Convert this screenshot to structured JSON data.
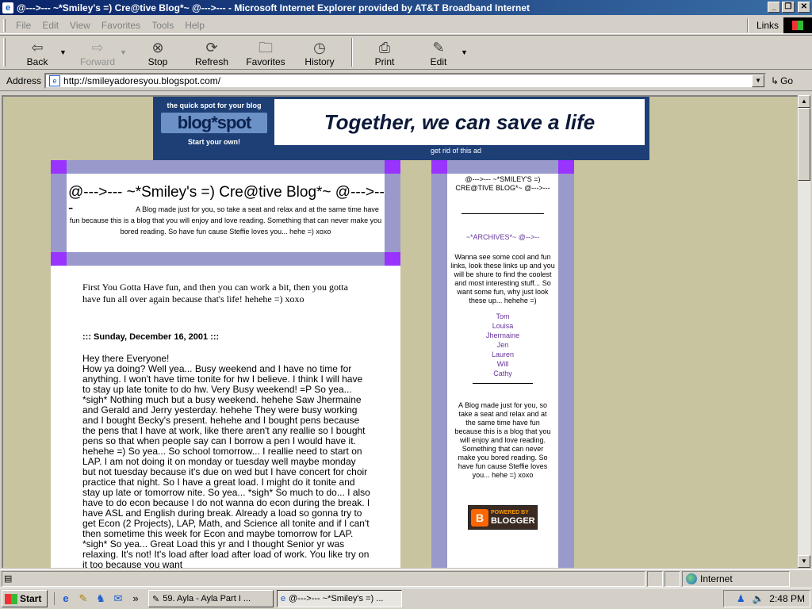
{
  "window": {
    "title": "@--->--- ~*Smiley's =) Cre@tive Blog*~ @--->--- - Microsoft Internet Explorer provided by AT&T Broadband Internet",
    "min_icon": "_",
    "max_icon": "❐",
    "close_icon": "✕"
  },
  "menubar": {
    "items": [
      "File",
      "Edit",
      "View",
      "Favorites",
      "Tools",
      "Help"
    ],
    "links_label": "Links"
  },
  "toolbar": {
    "buttons": [
      {
        "label": "Back",
        "icon": "back-arrow-icon",
        "glyph": "⇦"
      },
      {
        "label": "Forward",
        "icon": "forward-arrow-icon",
        "glyph": "⇨"
      },
      {
        "label": "Stop",
        "icon": "stop-icon",
        "glyph": "⊗"
      },
      {
        "label": "Refresh",
        "icon": "refresh-icon",
        "glyph": "⟳"
      },
      {
        "label": "Favorites",
        "icon": "favorites-icon",
        "glyph": "🗀"
      },
      {
        "label": "History",
        "icon": "history-icon",
        "glyph": "◷"
      },
      {
        "label": "Print",
        "icon": "printer-icon",
        "glyph": "⎙"
      },
      {
        "label": "Edit",
        "icon": "edit-icon",
        "glyph": "✎"
      }
    ]
  },
  "addressbar": {
    "label": "Address",
    "url": "http://smileyadoresyou.blogspot.com/",
    "go_label": "Go"
  },
  "ad": {
    "tagline": "the quick spot for your blog",
    "logo": "blog*spot",
    "start": "Start your own!",
    "slogan": "Together, we can save a life",
    "rid": "get rid of this ad"
  },
  "blog": {
    "title": "@--->--- ~*Smiley's =) Cre@tive Blog*~ @--->---",
    "description": "A Blog made just for you, so take a seat and relax and at the same time have fun because this is a blog that you will enjoy and love reading. Something that can never make you bored reading. So have fun cause Steffie loves you... hehe =) xoxo",
    "intro": "First You Gotta Have fun, and then you can work a bit, then you gotta have fun all over again because that's life! hehehe =) xoxo",
    "post_date": "::: Sunday, December 16, 2001 :::",
    "post_greeting": "Hey there Everyone!",
    "post_body": "How ya doing? Well yea... Busy weekend and I have no time for anything. I won't have time tonite for hw I believe. I think I will have to stay up late tonite to do hw. Very Busy weekend! =P So yea... *sigh* Nothing much but a busy weekend. hehehe Saw Jhermaine and Gerald and Jerry yesterday. hehehe They were busy working and I bought Becky's present. hehehe and I bought pens because the pens that I have at work, like there aren't any reallie so I bought pens so that when people say can I borrow a pen I would have it. hehehe =) So yea... So school tomorrow... I reallie need to start on LAP. I am not doing it on monday or tuesday well maybe monday but not tuesday because it's due on wed but I have concert for choir practice that night. So I have a great load. I might do it tonite and stay up late or tomorrow nite. So yea... *sigh* So much to do... I also have to do econ because I do not wanna do econ during the break. I have ASL and English during break. Already a load so gonna try to get Econ (2 Projects), LAP, Math, and Science all tonite and if I can't then sometime this week for Econ and maybe tomorrow for LAP. *sigh* So yea... Great Load this yr and I thought Senior yr was relaxing. It's not! It's load after load after load of work. You like try on it too because you want"
  },
  "sidebar": {
    "title": "@--->--- ~*SMILEY'S =) CRE@TIVE BLOG*~ @--->---",
    "archives": "~*ARCHIVES*~ @-->--",
    "blurb": "Wanna see some cool and fun links, look these links up and you will be shure to find the coolest and most interesting stuff... So want some fun, why just look these up... hehehe =)",
    "friends": [
      "Tom",
      "Louisa",
      "Jhermaine",
      "Jen",
      "Lauren",
      "Will",
      "Cathy"
    ],
    "description": "A Blog made just for you, so take a seat and relax and at the same time have fun because this is a blog that you will enjoy and love reading. Something that can never make you bored reading. So have fun cause Steffie loves you... hehe =) xoxo",
    "badge_top": "POWERED BY",
    "badge_bottom": "BLOGGER",
    "badge_letter": "B"
  },
  "statusbar": {
    "zone": "Internet"
  },
  "taskbar": {
    "start": "Start",
    "more": "»",
    "tasks": [
      {
        "label": "59. Ayla - Ayla Part I ..."
      },
      {
        "label": "@--->--- ~*Smiley's =) ..."
      }
    ],
    "clock": "2:48 PM"
  }
}
